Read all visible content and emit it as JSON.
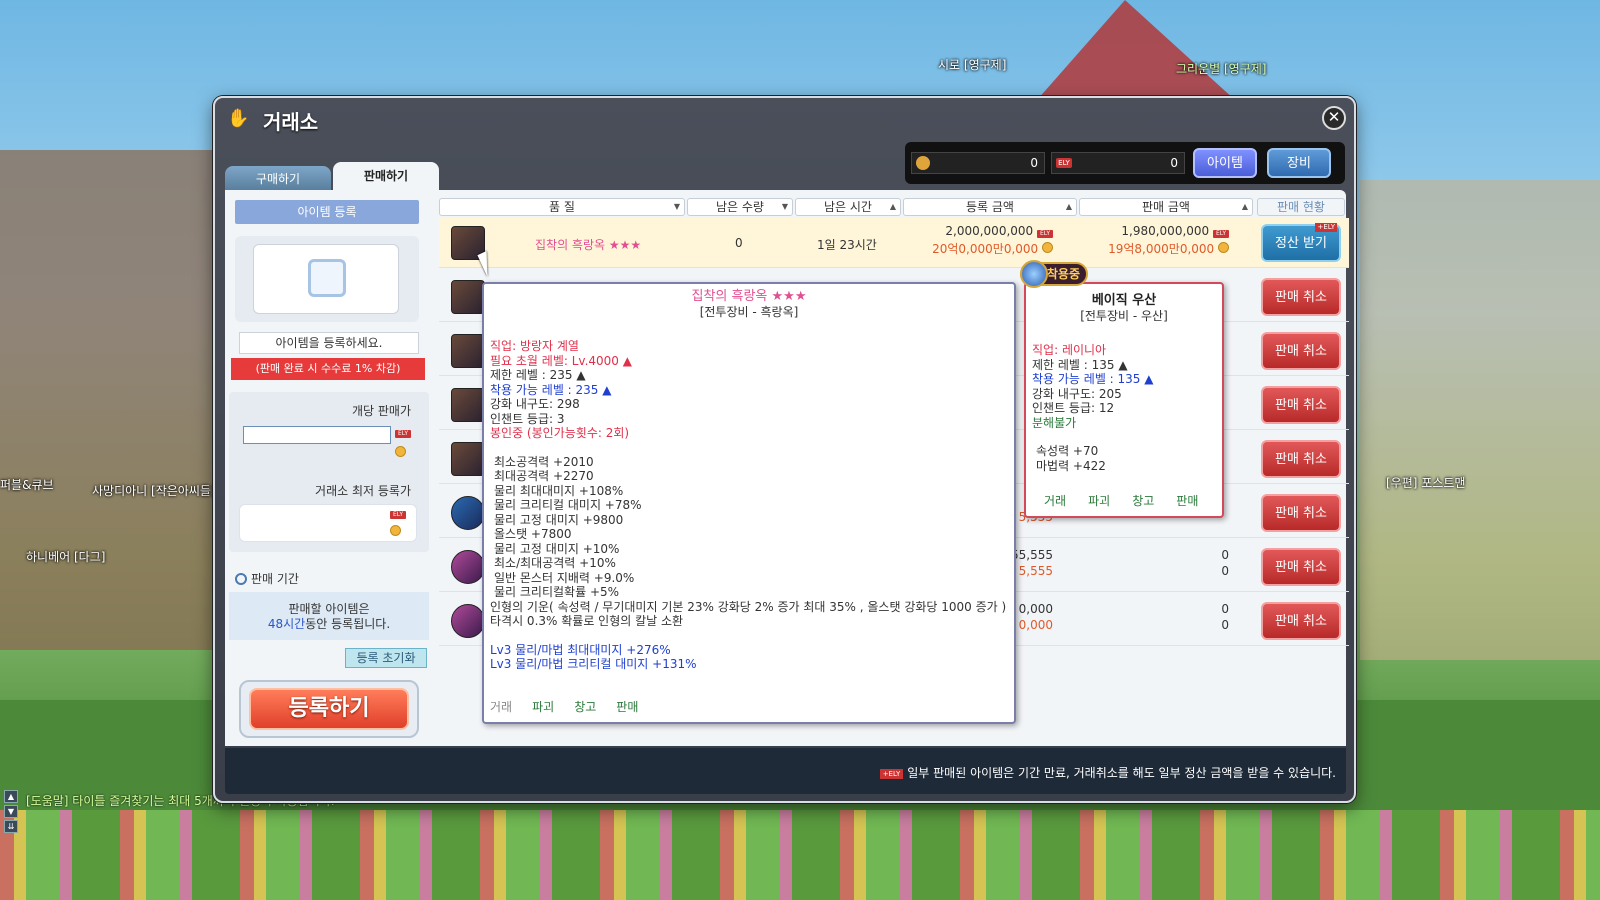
{
  "world": {
    "npc_names": [
      "시로 [영구제]",
      "그리운별 [영구제]",
      "사망디아니 [작은아씨들]",
      "하니베어 [다그]",
      "[우편] 포스트맨",
      "퍼블&큐브"
    ],
    "chat_line": "[도움말] 타이틀 즐겨찾기는 최대 5개까지 설정이 가능합니다."
  },
  "window": {
    "title": "거래소",
    "close_label": "✕",
    "tabs": [
      {
        "label": "구매하기",
        "active": false
      },
      {
        "label": "판매하기",
        "active": true
      }
    ],
    "currency": {
      "meso": "0",
      "ely": "0",
      "ely_icon": "ELY"
    },
    "category_buttons": {
      "item": "아이템",
      "equip": "장비"
    }
  },
  "left_panel": {
    "register_title": "아이템 등록",
    "register_prompt": "아이템을 등록하세요.",
    "fee_notice": "(판매 완료 시 수수료 1% 차감)",
    "unit_price_label": "개당 판매가",
    "unit_price_value": "",
    "lowest_price_label": "거래소 최저 등록가",
    "period_label": "판매 기간",
    "period_line1": "판매할 아이템은",
    "period_hours": "48시간",
    "period_line2": "동안 등록됩니다.",
    "reset_button": "등록 초기화",
    "register_button": "등록하기"
  },
  "table": {
    "headers": [
      "품 질",
      "남은 수량",
      "남은 시간",
      "등록 금액",
      "판매 금액",
      "판매 현황"
    ],
    "rows": [
      {
        "name": "집착의 흑랑옥",
        "stars": "★★★",
        "qty": "0",
        "time": "1일 23시간",
        "reg_ely": "2,000,000,000",
        "reg_meso": "20억0,000만0,000",
        "sale_ely": "1,980,000,000",
        "sale_meso": "19억8,000만0,000",
        "action": "정산 받기",
        "selected": true
      },
      {
        "name": "",
        "stars": "",
        "qty": "",
        "time": "",
        "reg_ely": "",
        "reg_meso": "",
        "sale_ely": "",
        "sale_meso": "",
        "action": "판매 취소"
      },
      {
        "name": "",
        "stars": "",
        "qty": "",
        "time": "",
        "reg_ely": "",
        "reg_meso": "",
        "sale_ely": "",
        "sale_meso": "",
        "action": "판매 취소"
      },
      {
        "name": "",
        "stars": "",
        "qty": "",
        "time": "",
        "reg_ely": "",
        "reg_meso": "",
        "sale_ely": "",
        "sale_meso": "",
        "action": "판매 취소"
      },
      {
        "name": "",
        "stars": "",
        "qty": "",
        "time": "",
        "reg_ely": "",
        "reg_meso": "",
        "sale_ely": "",
        "sale_meso": "",
        "action": "판매 취소"
      },
      {
        "name": "",
        "stars": "",
        "qty": "",
        "time": "",
        "reg_ely": "55",
        "reg_meso": "5,555",
        "sale_ely": "",
        "sale_meso": "",
        "action": "판매 취소"
      },
      {
        "name": "",
        "stars": "",
        "qty": "",
        "time": "",
        "reg_ely": "55,555",
        "reg_meso": "5,555",
        "sale_ely": "0",
        "sale_meso": "0",
        "action": "판매 취소"
      },
      {
        "name": "",
        "stars": "",
        "qty": "",
        "time": "",
        "reg_ely": "0,000",
        "reg_meso": "0,000",
        "sale_ely": "0",
        "sale_meso": "0",
        "action": "판매 취소"
      }
    ],
    "settle_badge": "+ELY"
  },
  "footer": {
    "badge": "+ELY",
    "message": "일부 판매된 아이템은 기간 만료, 거래취소를 해도 일부 정산 금액을 받을 수 있습니다."
  },
  "tooltip_main": {
    "title": "집착의 흑랑옥 ★★★",
    "subtitle": "[전투장비 - 흑랑옥]",
    "job": "직업: 방랑자 계열",
    "req_level": "필요 초월 레벨: Lv.4000 ▲",
    "limit_level": "제한 레벨 : 235 ▲",
    "wear_level": "착용 가능 레벨 : 235 ▲",
    "durability": "강화 내구도: 298",
    "enchant": "인챈트 등급: 3",
    "seal": "봉인중 (봉인가능횟수: 2회)",
    "stats": [
      "최소공격력 +2010",
      "최대공격력 +2270",
      "물리 최대대미지 +108%",
      "물리 크리티컬 대미지 +78%",
      "물리 고정 대미지 +9800",
      "올스탯 +7800",
      "물리 고정 대미지 +10%",
      "최소/최대공격력 +10%",
      "일반 몬스터 지배력 +9.0%",
      "물리 크리티컬확률 +5%",
      "인형의 기운( 속성력 / 무기대미지 기본 23% 강화당 2% 증가 최대 35% , 올스탯 강화당 1000 증가 )",
      "타격시 0.3% 확률로 인형의 칼날 소환"
    ],
    "bonus": [
      "Lv3 물리/마법 최대대미지 +276%",
      "Lv3 물리/마법 크리티컬 대미지 +131%"
    ],
    "actions": [
      "거래",
      "파괴",
      "창고",
      "판매"
    ]
  },
  "tooltip_equipped": {
    "badge": "착용중",
    "title": "베이직 우산",
    "subtitle": "[전투장비 - 우산]",
    "job": "직업: 레이니아",
    "limit_level": "제한 레벨 : 135 ▲",
    "wear_level": "착용 가능 레벨 : 135 ▲",
    "durability": "강화 내구도: 205",
    "enchant": "인챈트 등급: 12",
    "unbreakable": "분해불가",
    "stats": [
      "속성력 +70",
      "마법력 +422"
    ],
    "actions": [
      "거래",
      "파괴",
      "창고",
      "판매"
    ]
  }
}
